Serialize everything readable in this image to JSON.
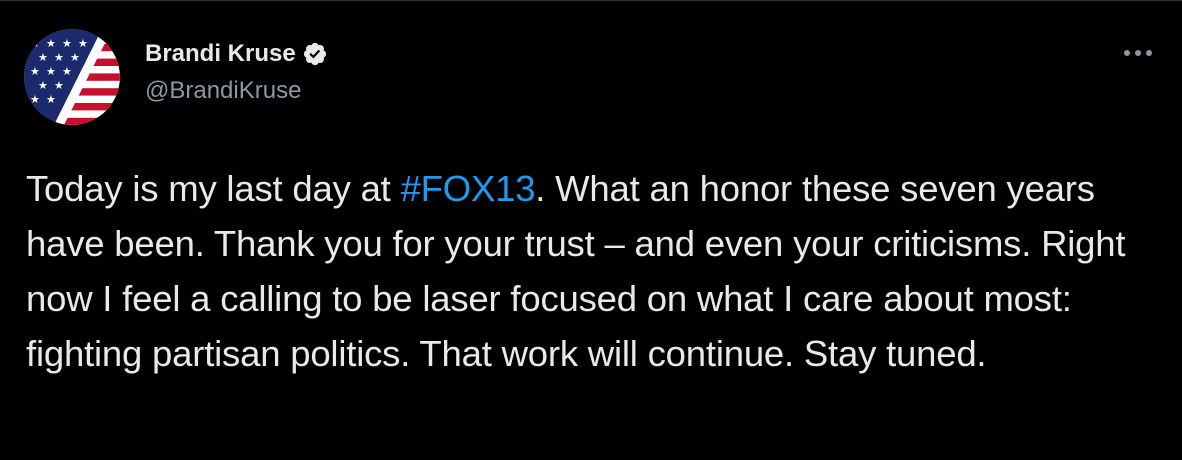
{
  "author": {
    "display_name": "Brandi Kruse",
    "handle": "@BrandiKruse",
    "verified": true
  },
  "icons": {
    "avatar": "american-flag-avatar",
    "verified": "verified-badge-icon",
    "more": "more-horizontal-icon"
  },
  "tweet": {
    "text_before": "Today is my last day at ",
    "hashtag": "#FOX13",
    "text_after": ". What an honor these seven years have been. Thank you for your trust – and even your criticisms. Right now I feel a calling to be laser focused on what I care about most: fighting partisan politics. That work will continue. Stay tuned."
  },
  "colors": {
    "background": "#000000",
    "text": "#e7e9ea",
    "secondary": "#8b98a5",
    "link": "#1d9bf0",
    "border": "#2f3336"
  }
}
